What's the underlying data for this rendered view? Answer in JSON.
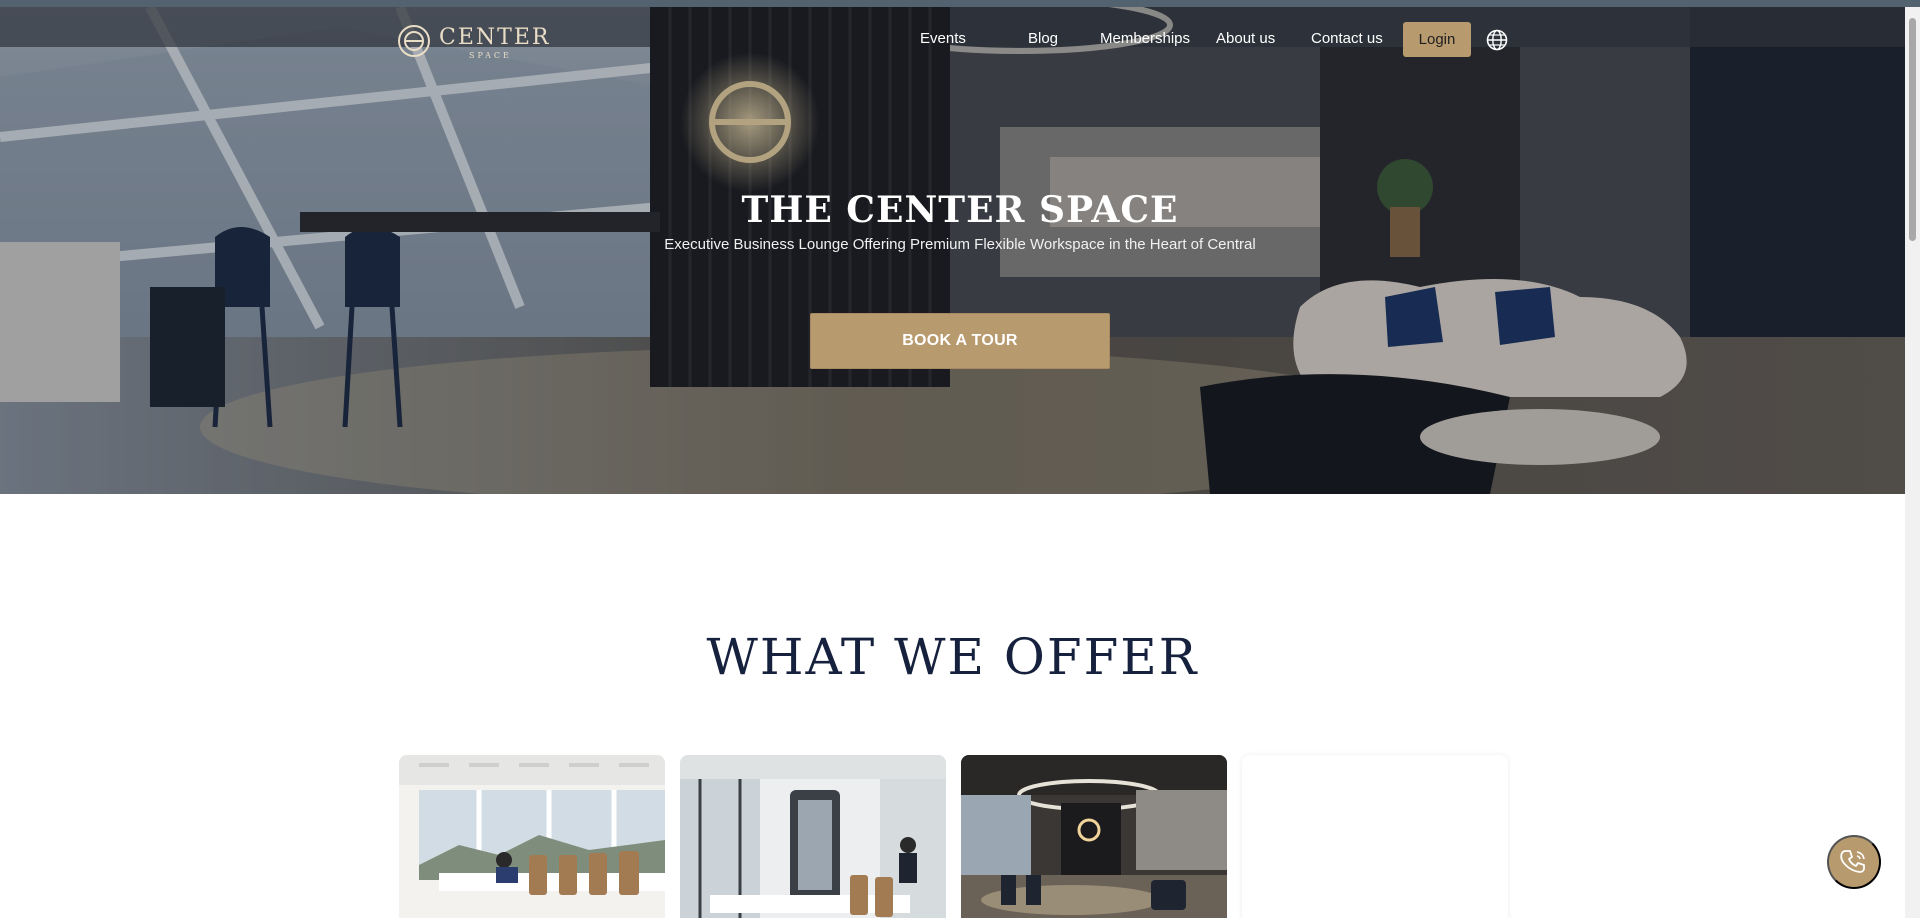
{
  "brand": {
    "name": "CENTER",
    "sub": "SPACE"
  },
  "nav": {
    "links": [
      {
        "label": "Events"
      },
      {
        "label": "Blog"
      },
      {
        "label": "Memberships"
      },
      {
        "label": "About us"
      },
      {
        "label": "Contact us"
      }
    ],
    "login_label": "Login",
    "language_icon": "globe-icon"
  },
  "hero": {
    "title": "THE CENTER SPACE",
    "subtitle": "Executive Business Lounge Offering Premium Flexible Workspace in the Heart of Central",
    "cta_label": "BOOK A TOUR"
  },
  "offer": {
    "title": "WHAT WE OFFER"
  },
  "fab": {
    "icon": "phone-call-icon"
  },
  "colors": {
    "accent": "#b89a6f",
    "navy": "#16213d"
  }
}
